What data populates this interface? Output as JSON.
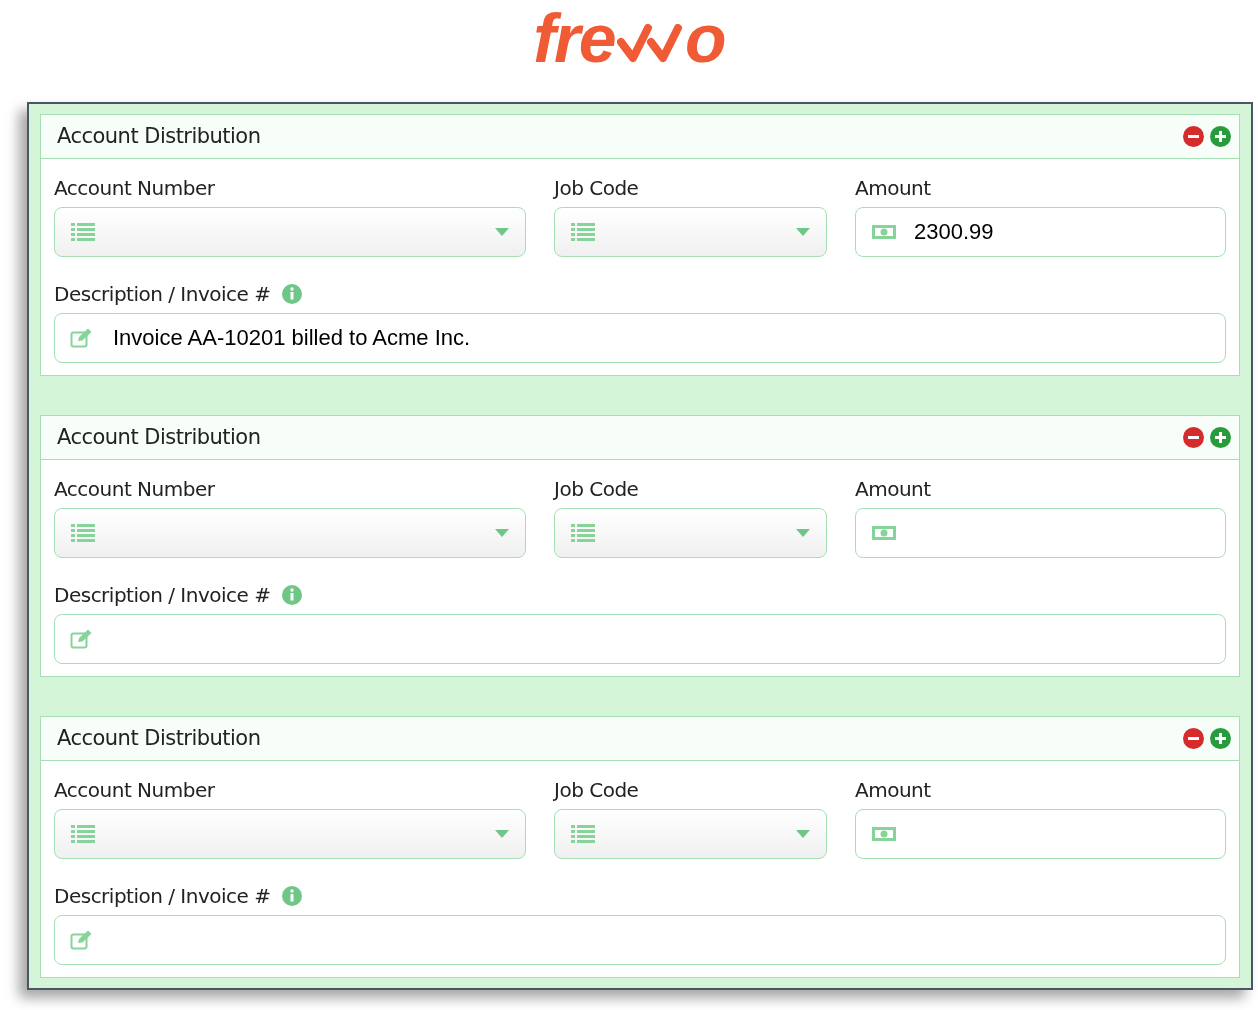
{
  "logo": {
    "prefix": "fre",
    "suffix": "o"
  },
  "sections": [
    {
      "title": "Account Distribution",
      "account_number": {
        "label": "Account Number"
      },
      "job_code": {
        "label": "Job Code"
      },
      "amount": {
        "label": "Amount",
        "value": "2300.99"
      },
      "description": {
        "label": "Description / Invoice #",
        "value": "Invoice AA-10201 billed to Acme Inc."
      }
    },
    {
      "title": "Account Distribution",
      "account_number": {
        "label": "Account Number"
      },
      "job_code": {
        "label": "Job Code"
      },
      "amount": {
        "label": "Amount"
      },
      "description": {
        "label": "Description / Invoice #"
      }
    },
    {
      "title": "Account Distribution",
      "account_number": {
        "label": "Account Number"
      },
      "job_code": {
        "label": "Job Code"
      },
      "amount": {
        "label": "Amount"
      },
      "description": {
        "label": "Description / Invoice #"
      }
    }
  ]
}
